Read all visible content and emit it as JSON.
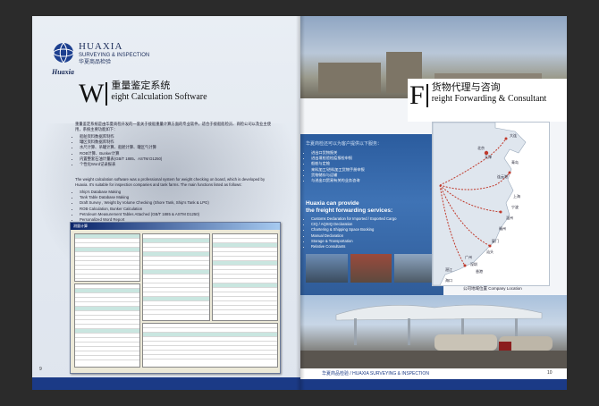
{
  "left_page": {
    "brand": {
      "name_en": "HUAXIA",
      "subtitle": "SURVEYING & INSPECTION",
      "name_cn": "华夏商品检验",
      "script_name": "Huaxia"
    },
    "section": {
      "initial": "W",
      "title_cn": "重量鉴定系统",
      "title_en": "eight Calculation Software"
    },
    "intro_cn": "重量鉴定系统是由华夏商检开发的一套关于接船重量计算方面的专业软件，适合于接船船检员、商检公司以及业主使用，系统主要功能如下：",
    "features_cn": [
      "船舶资料数据库制作",
      "罐区资料数据库制作",
      "水尺计算、吊罐计算、船舱计算、罐区气计算",
      "ROB计算、Bunker计算",
      "内置整套石油计量表(GB/T 1885、ASTM D1250)",
      "个性化Word记录报表"
    ],
    "intro_en": "The weight calculation software was a professional system for weight checking on board, which is developed by Huaxia. It's suitable for inspection companies and tank farms. The main functions listed as follows:",
    "features_en": [
      "Ship's Database Making",
      "Tank Table Database Making",
      "Draft Survey , Weight by Volume Checking (Shore Tank, Ship's Tank & LPG)",
      "ROB Calculation, Bunker Calculation",
      "Petroleum Measurement Tables Attached (GB/T 1885 & ASTM D1250)",
      "Personalized Word Report"
    ],
    "software_window_title": "测量计算",
    "page_number": "9"
  },
  "right_page": {
    "section": {
      "initial": "F",
      "title_cn": "货物代理与咨询",
      "title_en": "reight Forwarding & Consultant"
    },
    "services_head_cn": "华夏商检还可以为客户提供以下服务：",
    "services_cn": [
      "进出口货物报关",
      "进出境检验检疫报检申报",
      "船舶与定舱",
      "来料加工/进料加工货物手册申报",
      "货物储存与运输",
      "与进出口贸易有关的业务咨询"
    ],
    "services_head_en_1": "Huaxia can provide",
    "services_head_en_2": "the freight forwarding services:",
    "services_en": [
      "Customs Declaration for Imported / Exported Cargo",
      "CIQ / AQSIQ Declaration",
      "Chartering & Shipping Space Booking",
      "Manual Declaration",
      "Storage & Transportation",
      "Relative Consultants"
    ],
    "map_caption": "公司地域位置  Company Location",
    "map_cities": [
      "北京",
      "天津",
      "大连",
      "青岛",
      "连云港",
      "上海",
      "宁波",
      "温州",
      "福州",
      "厦门",
      "汕头",
      "广州",
      "深圳",
      "香港",
      "湛江",
      "海口"
    ],
    "footer_text": "华夏商品检验 / HUAXIA SURVEYING & INSPECTION",
    "page_number": "10"
  },
  "colors": {
    "brand_navy": "#1b3a86",
    "panel_blue": "#3f73b5",
    "heading_light": "#cfe0f5"
  }
}
